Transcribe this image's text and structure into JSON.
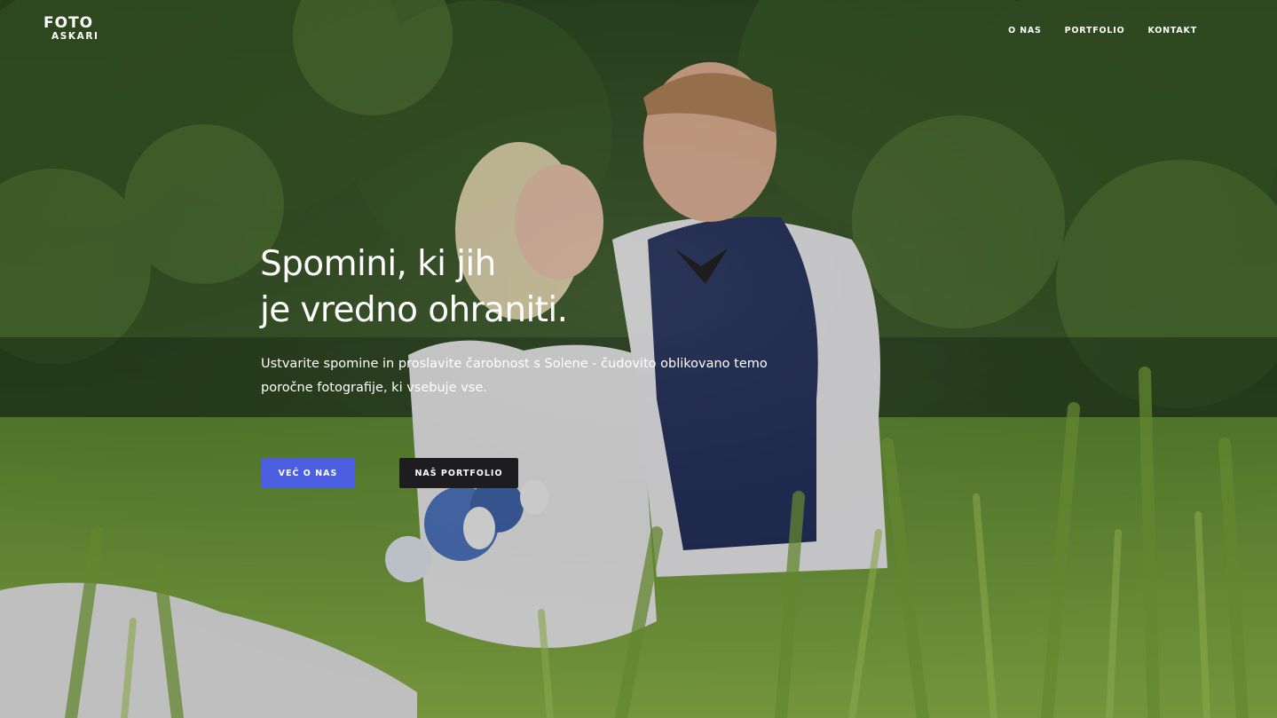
{
  "header": {
    "logo_top": "FOTO",
    "logo_bottom": "ASKARI",
    "nav": [
      "O NAS",
      "PORTFOLIO",
      "KONTAKT"
    ]
  },
  "hero": {
    "headline_line1": "Spomini, ki jih",
    "headline_line2": "je vredno ohraniti.",
    "lead_line1": "Ustvarite spomine in proslavite čarobnost s Solene - čudovito oblikovano temo",
    "lead_line2": "poročne fotografije, ki vsebuje vse.",
    "primary_button": "VEČ O NAS",
    "secondary_button": "NAŠ PORTFOLIO"
  },
  "colors": {
    "primary_button": "#4c5ee0",
    "secondary_button": "#1d1d1f",
    "text": "#ffffff"
  }
}
